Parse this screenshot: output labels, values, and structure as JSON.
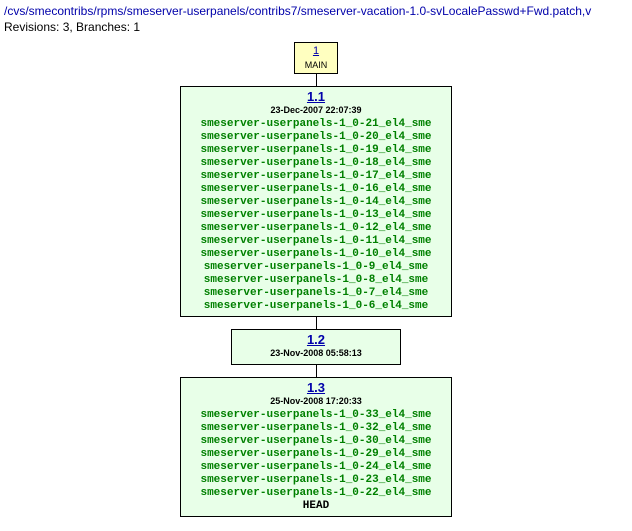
{
  "path": "/cvs/smecontribs/rpms/smeserver-userpanels/contribs7/smeserver-vacation-1.0-svLocalePasswd+Fwd.patch,v",
  "meta": "Revisions: 3, Branches: 1",
  "main": {
    "num": "1",
    "branch": "MAIN"
  },
  "rev11": {
    "title": "1.1",
    "date": "23-Dec-2007 22:07:39",
    "tags": [
      "smeserver-userpanels-1_0-21_el4_sme",
      "smeserver-userpanels-1_0-20_el4_sme",
      "smeserver-userpanels-1_0-19_el4_sme",
      "smeserver-userpanels-1_0-18_el4_sme",
      "smeserver-userpanels-1_0-17_el4_sme",
      "smeserver-userpanels-1_0-16_el4_sme",
      "smeserver-userpanels-1_0-14_el4_sme",
      "smeserver-userpanels-1_0-13_el4_sme",
      "smeserver-userpanels-1_0-12_el4_sme",
      "smeserver-userpanels-1_0-11_el4_sme",
      "smeserver-userpanels-1_0-10_el4_sme",
      "smeserver-userpanels-1_0-9_el4_sme",
      "smeserver-userpanels-1_0-8_el4_sme",
      "smeserver-userpanels-1_0-7_el4_sme",
      "smeserver-userpanels-1_0-6_el4_sme"
    ]
  },
  "rev12": {
    "title": "1.2",
    "date": "23-Nov-2008 05:58:13"
  },
  "rev13": {
    "title": "1.3",
    "date": "25-Nov-2008 17:20:33",
    "tags": [
      "smeserver-userpanels-1_0-33_el4_sme",
      "smeserver-userpanels-1_0-32_el4_sme",
      "smeserver-userpanels-1_0-30_el4_sme",
      "smeserver-userpanels-1_0-29_el4_sme",
      "smeserver-userpanels-1_0-24_el4_sme",
      "smeserver-userpanels-1_0-23_el4_sme",
      "smeserver-userpanels-1_0-22_el4_sme"
    ],
    "head": "HEAD"
  },
  "chart_data": {
    "type": "tree",
    "branch": "MAIN",
    "revisions": [
      {
        "rev": "1.1",
        "date": "23-Dec-2007 22:07:39",
        "tag_count": 15
      },
      {
        "rev": "1.2",
        "date": "23-Nov-2008 05:58:13",
        "tag_count": 0
      },
      {
        "rev": "1.3",
        "date": "25-Nov-2008 17:20:33",
        "tag_count": 7,
        "head": true
      }
    ],
    "total_revisions": 3,
    "total_branches": 1
  }
}
